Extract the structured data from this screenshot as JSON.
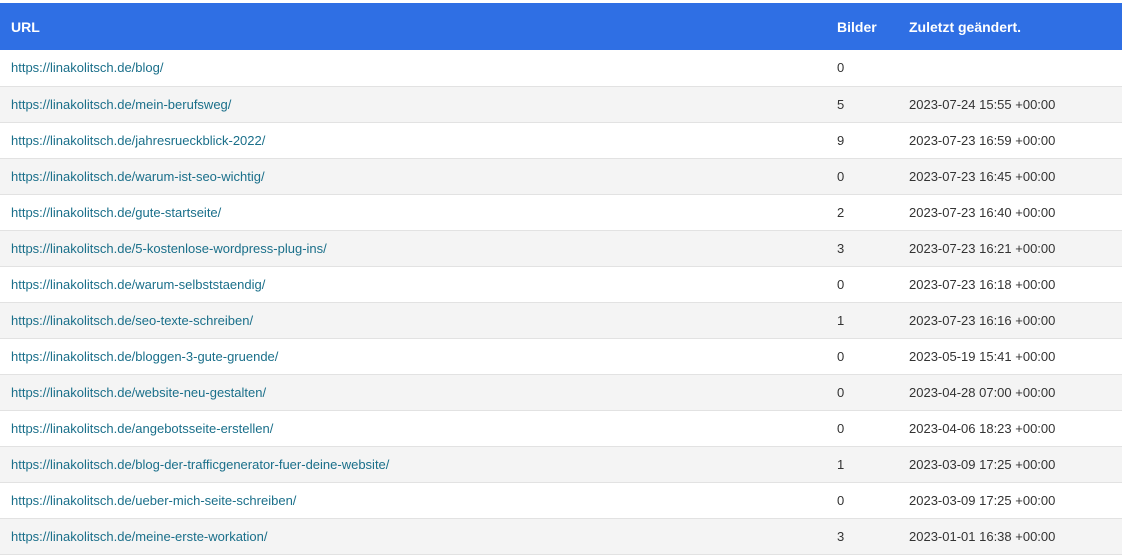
{
  "table": {
    "headers": {
      "url": "URL",
      "images": "Bilder",
      "modified": "Zuletzt geändert."
    },
    "rows": [
      {
        "url": "https://linakolitsch.de/blog/",
        "images": "0",
        "modified": ""
      },
      {
        "url": "https://linakolitsch.de/mein-berufsweg/",
        "images": "5",
        "modified": "2023-07-24 15:55 +00:00"
      },
      {
        "url": "https://linakolitsch.de/jahresrueckblick-2022/",
        "images": "9",
        "modified": "2023-07-23 16:59 +00:00"
      },
      {
        "url": "https://linakolitsch.de/warum-ist-seo-wichtig/",
        "images": "0",
        "modified": "2023-07-23 16:45 +00:00"
      },
      {
        "url": "https://linakolitsch.de/gute-startseite/",
        "images": "2",
        "modified": "2023-07-23 16:40 +00:00"
      },
      {
        "url": "https://linakolitsch.de/5-kostenlose-wordpress-plug-ins/",
        "images": "3",
        "modified": "2023-07-23 16:21 +00:00"
      },
      {
        "url": "https://linakolitsch.de/warum-selbststaendig/",
        "images": "0",
        "modified": "2023-07-23 16:18 +00:00"
      },
      {
        "url": "https://linakolitsch.de/seo-texte-schreiben/",
        "images": "1",
        "modified": "2023-07-23 16:16 +00:00"
      },
      {
        "url": "https://linakolitsch.de/bloggen-3-gute-gruende/",
        "images": "0",
        "modified": "2023-05-19 15:41 +00:00"
      },
      {
        "url": "https://linakolitsch.de/website-neu-gestalten/",
        "images": "0",
        "modified": "2023-04-28 07:00 +00:00"
      },
      {
        "url": "https://linakolitsch.de/angebotsseite-erstellen/",
        "images": "0",
        "modified": "2023-04-06 18:23 +00:00"
      },
      {
        "url": "https://linakolitsch.de/blog-der-trafficgenerator-fuer-deine-website/",
        "images": "1",
        "modified": "2023-03-09 17:25 +00:00"
      },
      {
        "url": "https://linakolitsch.de/ueber-mich-seite-schreiben/",
        "images": "0",
        "modified": "2023-03-09 17:25 +00:00"
      },
      {
        "url": "https://linakolitsch.de/meine-erste-workation/",
        "images": "3",
        "modified": "2023-01-01 16:38 +00:00"
      }
    ]
  },
  "colors": {
    "header_background": "#2f6fe4",
    "link": "#1a6f8a",
    "row_alternate": "#f4f4f4"
  }
}
